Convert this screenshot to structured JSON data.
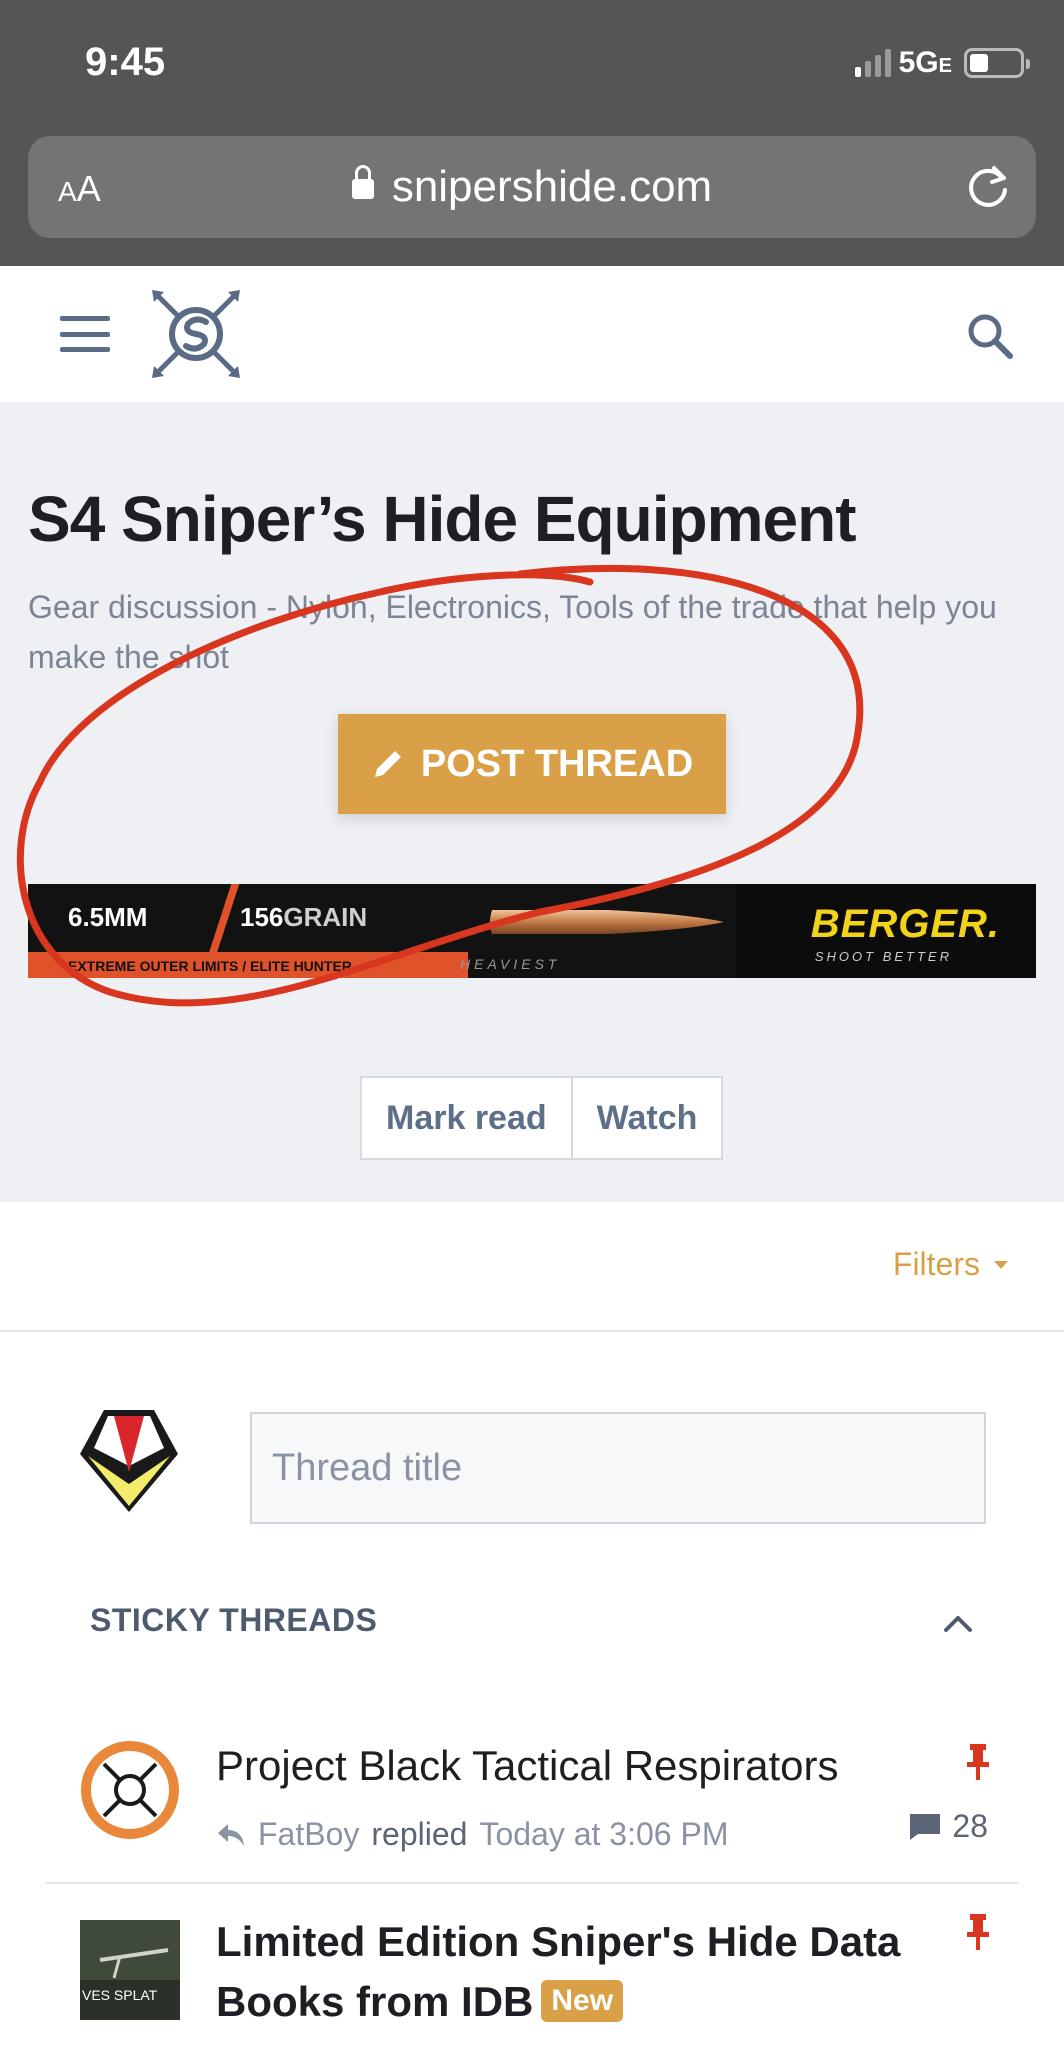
{
  "status": {
    "time": "9:45",
    "network": "5G",
    "network_suffix": "E"
  },
  "browser": {
    "text_size_label_small": "A",
    "text_size_label": "A",
    "url": "snipershide.com"
  },
  "forum": {
    "title": "S4 Sniper’s Hide Equipment",
    "description": "Gear discussion - Nylon, Electronics, Tools of the trade that help you make the shot",
    "post_thread_label": "POST THREAD",
    "mark_read_label": "Mark read",
    "watch_label": "Watch"
  },
  "banner": {
    "caliber": "6.5MM",
    "weight_num": "156",
    "weight_unit": "GRAIN",
    "subtitle": "EXTREME OUTER LIMITS  /  ELITE HUNTER",
    "heaviest": "HEAVIEST",
    "brand": "BERGER.",
    "tagline": "SHOOT BETTER"
  },
  "filters_label": "Filters",
  "quick_thread": {
    "placeholder": "Thread title"
  },
  "sticky": {
    "heading": "STICKY THREADS",
    "threads": [
      {
        "title": "Project Black Tactical Respirators",
        "user": "FatBoy",
        "action": "replied",
        "when": "Today at 3:06 PM",
        "replies": "28"
      },
      {
        "title": "Limited Edition Sniper's Hide Data Books from IDB",
        "badge": "New",
        "thumb_text": "VES SPLAT"
      }
    ]
  },
  "colors": {
    "accent": "#d9a047",
    "annotation": "#d8361f",
    "link_muted": "#5e6f8a"
  },
  "icons": [
    "lock-icon",
    "reload-icon",
    "hamburger-icon",
    "search-icon",
    "pencil-icon",
    "chevron-up-icon",
    "reply-icon",
    "pin-icon",
    "comment-icon"
  ]
}
